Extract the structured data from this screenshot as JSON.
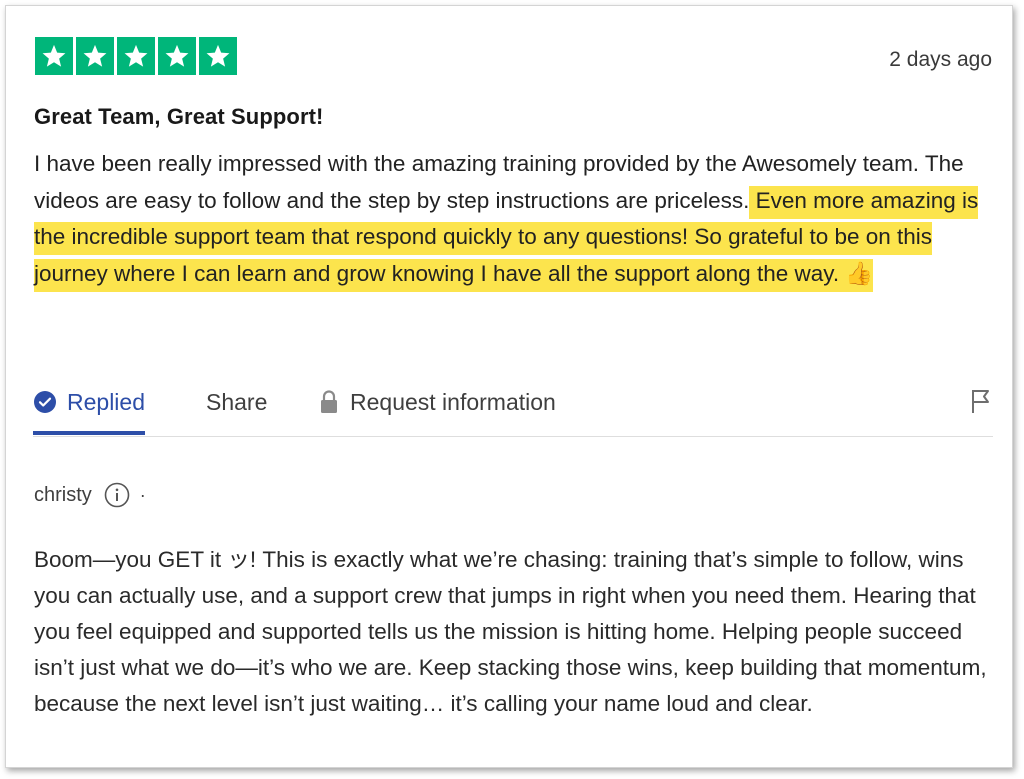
{
  "review": {
    "rating": 5,
    "rating_max": 5,
    "date": "2 days ago",
    "title": "Great Team, Great Support!",
    "body_plain": "I have been really impressed with the amazing training provided by the Awesomely team. The videos are easy to follow and the step by step instructions are priceless.",
    "body_highlighted": " Even more amazing is the incredible support team that respond quickly to any questions! So grateful to be on this journey where I can learn and grow knowing I have all the support along the way.",
    "body_emoji": "👍",
    "highlight_color": "#fce44d"
  },
  "actions": {
    "replied_label": "Replied",
    "share_label": "Share",
    "request_label": "Request information"
  },
  "reply": {
    "author": "christy",
    "separator": "·",
    "text": "Boom—you GET it ッ! This is exactly what we’re chasing: training that’s simple to follow, wins you can actually use, and a support crew that jumps in right when you need them. Hearing that you feel equipped and supported tells us the mission is hitting home. Helping people succeed isn’t just what we do—it’s who we are. Keep stacking those wins, keep building that momentum, because the next level isn’t just waiting… it’s calling your name loud and clear."
  },
  "colors": {
    "star_green": "#00b67a",
    "accent_blue": "#2d4ea8"
  },
  "icons": {
    "star": "star-icon",
    "replied": "check-circle-icon",
    "request": "lock-icon",
    "flag": "flag-icon",
    "info": "info-icon"
  }
}
